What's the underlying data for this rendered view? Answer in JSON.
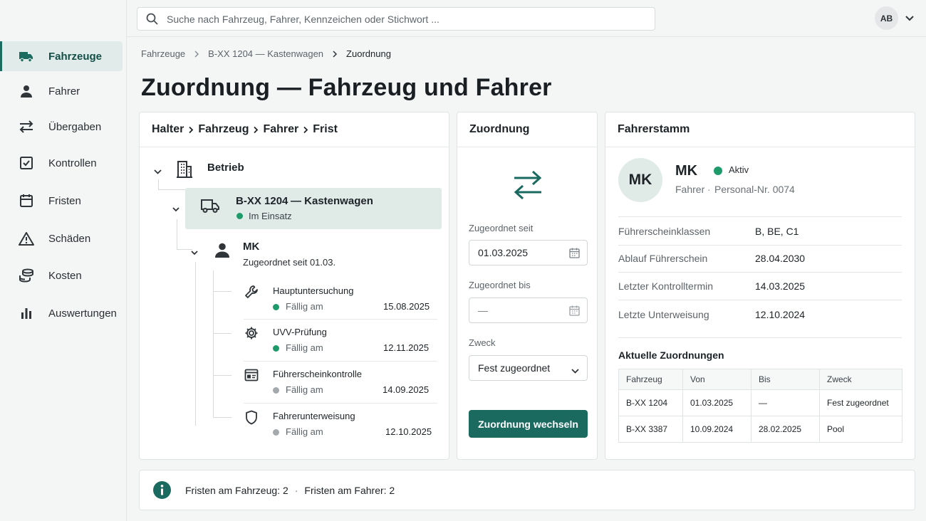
{
  "search": {
    "placeholder": "Suche nach Fahrzeug, Fahrer, Kennzeichen oder Stichwort ..."
  },
  "user": {
    "initials": "AB"
  },
  "sidebar": {
    "items": [
      {
        "label": "Fahrzeuge",
        "icon": "truck-icon",
        "active": true
      },
      {
        "label": "Fahrer",
        "icon": "person-icon"
      },
      {
        "label": "Übergaben",
        "icon": "swap-icon"
      },
      {
        "label": "Kontrollen",
        "icon": "checkbox-icon"
      },
      {
        "label": "Fristen",
        "icon": "calendar-icon"
      },
      {
        "label": "Schäden",
        "icon": "warning-icon"
      },
      {
        "label": "Kosten",
        "icon": "coins-icon"
      },
      {
        "label": "Auswertungen",
        "icon": "bar-chart-icon"
      }
    ]
  },
  "breadcrumb": [
    "Fahrzeuge",
    "B-XX 1204 — Kastenwagen",
    "Zuordnung"
  ],
  "page": {
    "title": "Zuordnung — Fahrzeug und Fahrer"
  },
  "tree": {
    "header": [
      "Halter",
      "Fahrzeug",
      "Fahrer",
      "Frist"
    ],
    "root": "Betrieb",
    "vehicle": {
      "name": "B-XX 1204",
      "type": "— Kastenwagen",
      "status": "Im Einsatz"
    },
    "driver": {
      "name": "MK",
      "sub": "Zugeordnet seit 01.03."
    },
    "deadlines": [
      {
        "title": "Hauptuntersuchung",
        "label": "Fällig am",
        "date": "15.08.2025",
        "status": "green",
        "icon": "wrench-icon"
      },
      {
        "title": "UVV-Prüfung",
        "label": "Fällig am",
        "date": "12.11.2025",
        "status": "green",
        "icon": "gear-icon"
      },
      {
        "title": "Führerscheinkontrolle",
        "label": "Fällig am",
        "date": "14.09.2025",
        "status": "gray",
        "icon": "id-card-icon"
      },
      {
        "title": "Fahrerunterweisung",
        "label": "Fällig am",
        "date": "12.10.2025",
        "status": "gray",
        "icon": "shield-icon"
      }
    ]
  },
  "assignment": {
    "title": "Zuordnung",
    "from_label": "Zugeordnet seit",
    "from_value": "01.03.2025",
    "to_label": "Zugeordnet bis",
    "to_value": "—",
    "purpose_label": "Zweck",
    "purpose_value": "Fest zugeordnet",
    "button": "Zuordnung wechseln"
  },
  "driver_master": {
    "title": "Fahrerstamm",
    "initials": "MK",
    "name": "MK",
    "status": "Aktiv",
    "role": "Fahrer",
    "personnel": "Personal-Nr. 0074",
    "fields": [
      {
        "label": "Führerscheinklassen",
        "value": "B, BE, C1"
      },
      {
        "label": "Ablauf Führerschein",
        "value": "28.04.2030"
      },
      {
        "label": "Letzter Kontrolltermin",
        "value": "14.03.2025"
      },
      {
        "label": "Letzte Unterweisung",
        "value": "12.10.2024"
      }
    ],
    "assignments_title": "Aktuelle Zuordnungen",
    "table": {
      "headers": [
        "Fahrzeug",
        "Von",
        "Bis",
        "Zweck"
      ],
      "rows": [
        [
          "B-XX 1204",
          "01.03.2025",
          "—",
          "Fest zugeordnet"
        ],
        [
          "B-XX 3387",
          "10.09.2024",
          "28.02.2025",
          "Pool"
        ]
      ]
    }
  },
  "footer": {
    "vehicle_deadlines": "Fristen am Fahrzeug: 2",
    "separator": "·",
    "driver_deadlines": "Fristen am Fahrer: 2"
  },
  "colors": {
    "accent": "#1a6a60",
    "active_bg": "#e1ebe9",
    "status_green": "#1e9a6b",
    "status_gray": "#a4a9ad"
  }
}
